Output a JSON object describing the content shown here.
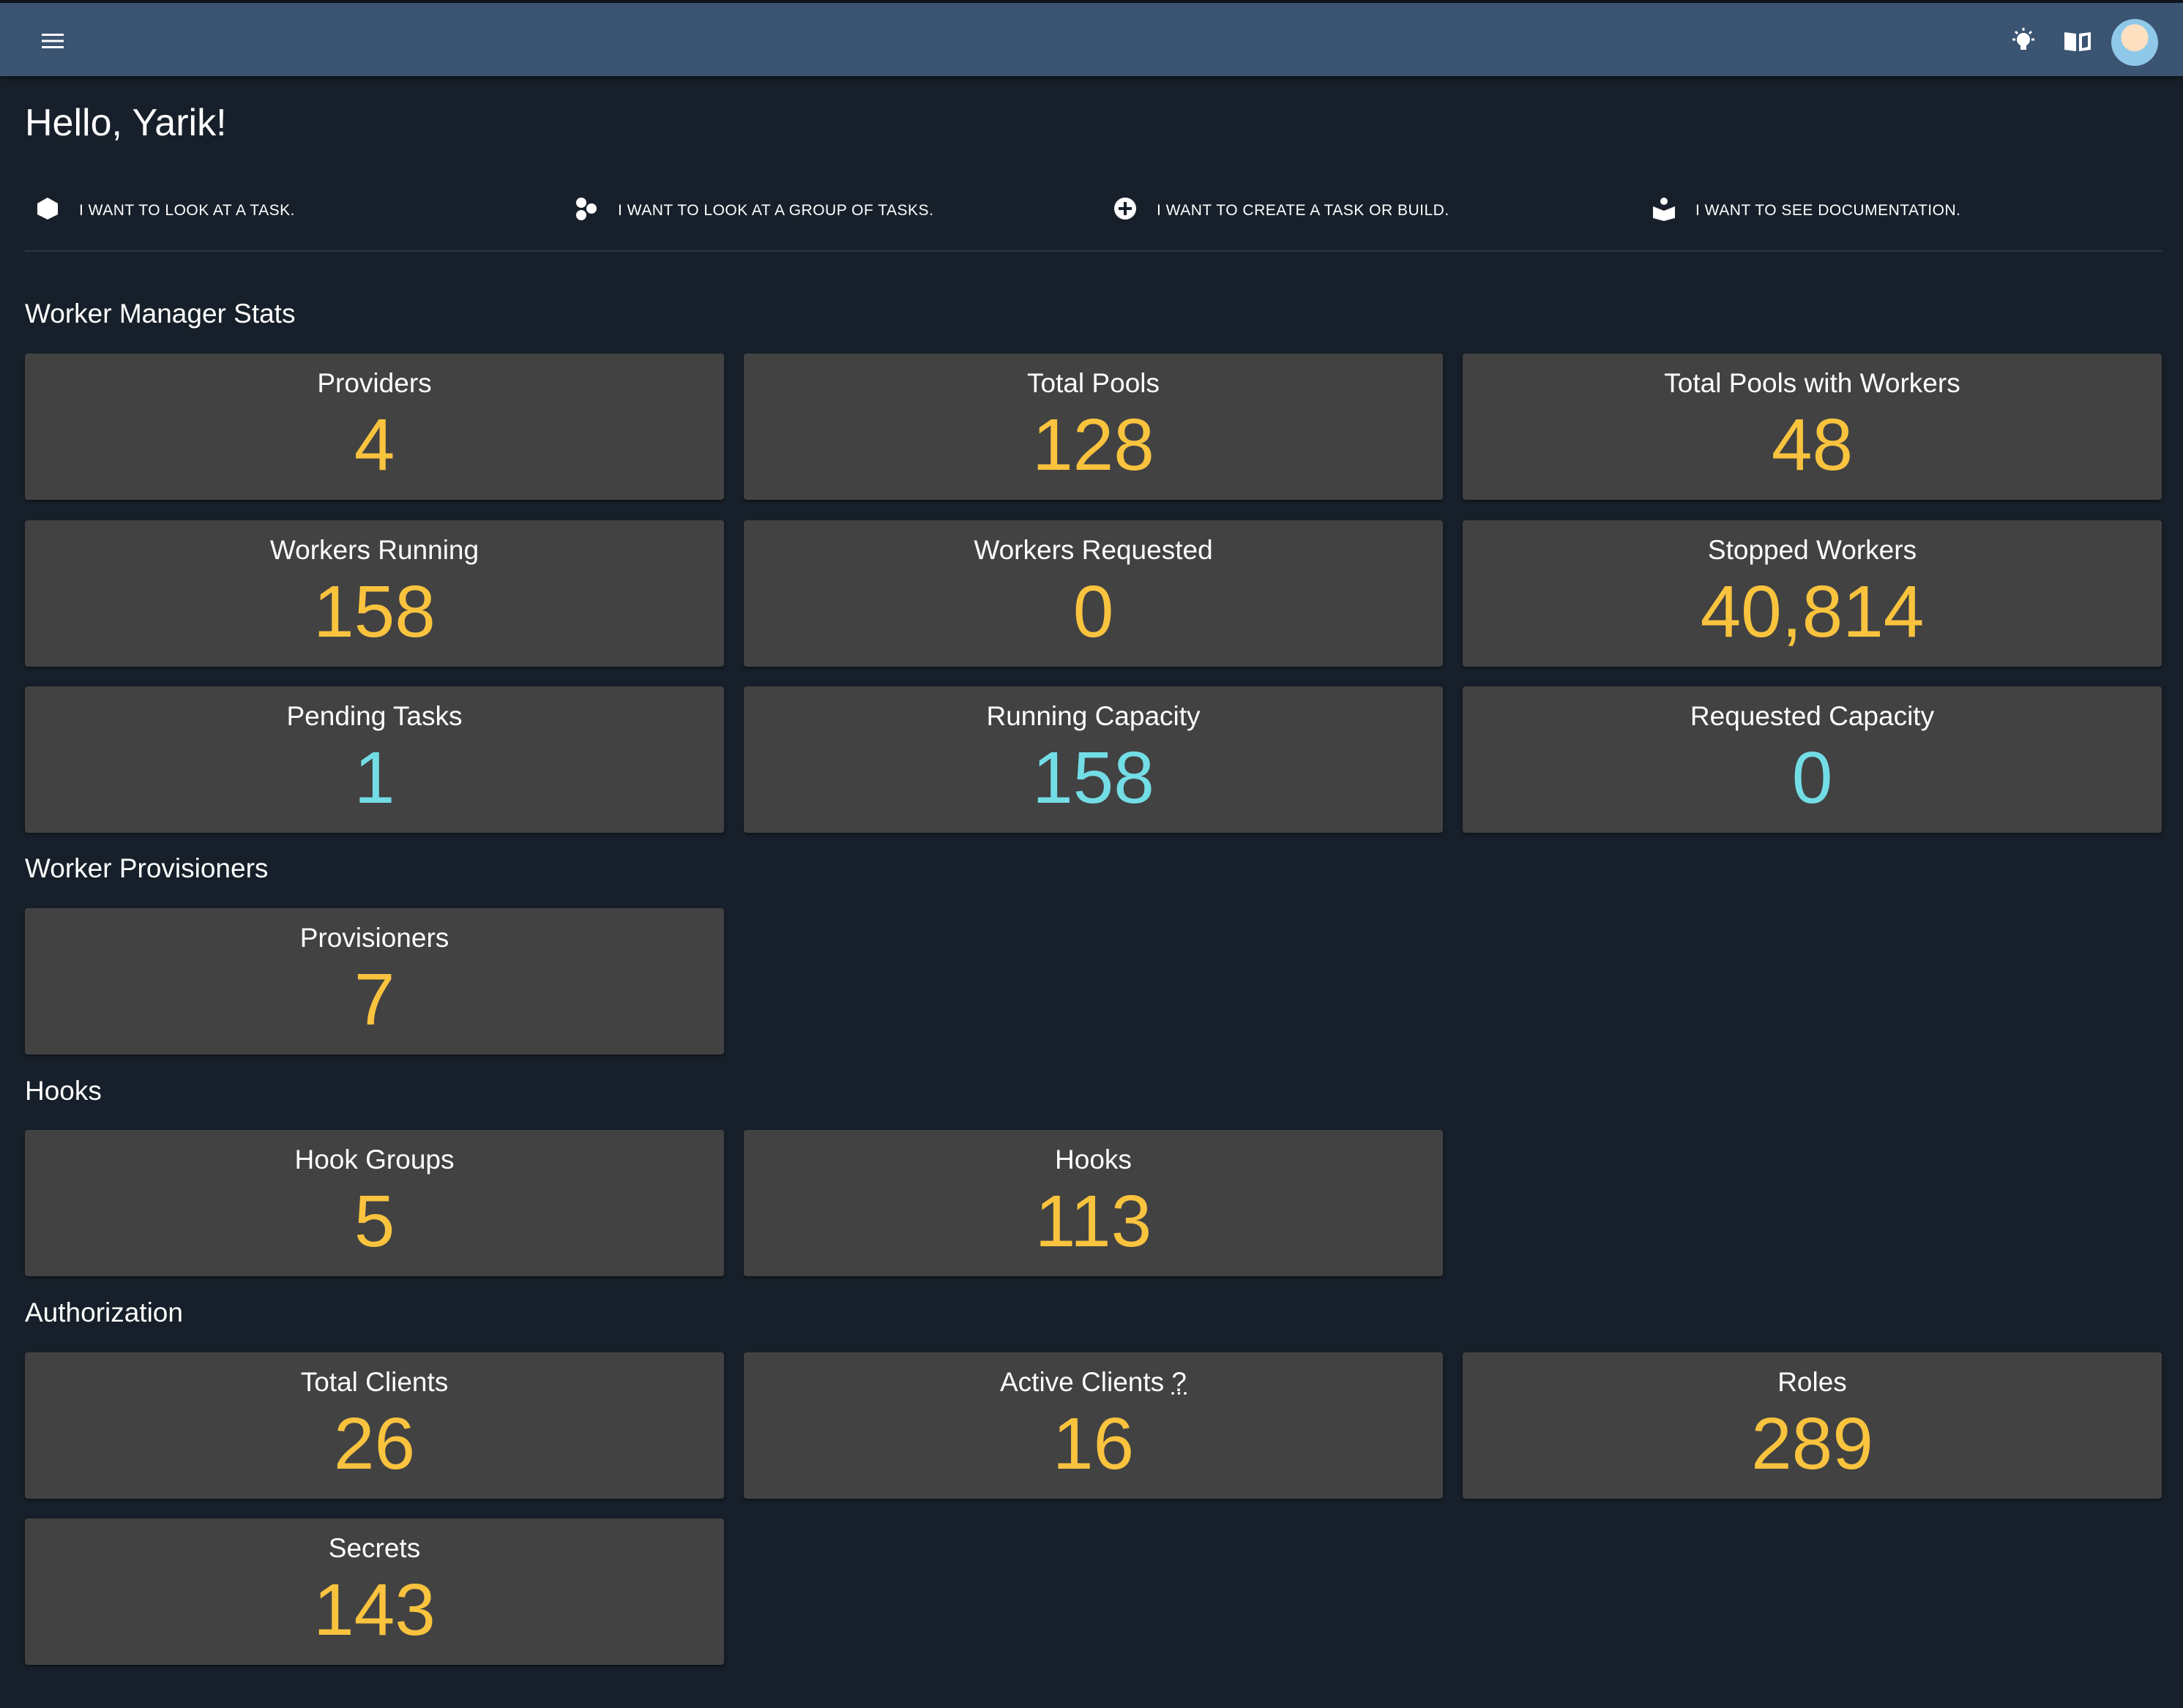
{
  "header": {
    "menu_icon": "menu-icon",
    "theme_icon": "lightbulb-icon",
    "docs_icon": "book-icon",
    "avatar_icon": "avatar"
  },
  "greeting": "Hello, Yarik!",
  "actions": [
    {
      "label": "I WANT TO LOOK AT A TASK.",
      "icon": "hexagon-icon"
    },
    {
      "label": "I WANT TO LOOK AT A GROUP OF TASKS.",
      "icon": "group-icon"
    },
    {
      "label": "I WANT TO CREATE A TASK OR BUILD.",
      "icon": "plus-circle-icon"
    },
    {
      "label": "I WANT TO SEE DOCUMENTATION.",
      "icon": "book-open-icon"
    }
  ],
  "sections": {
    "worker_manager": {
      "title": "Worker Manager Stats",
      "cards": [
        {
          "label": "Providers",
          "value": "4"
        },
        {
          "label": "Total Pools",
          "value": "128"
        },
        {
          "label": "Total Pools with Workers",
          "value": "48"
        },
        {
          "label": "Workers Running",
          "value": "158"
        },
        {
          "label": "Workers Requested",
          "value": "0"
        },
        {
          "label": "Stopped Workers",
          "value": "40,814"
        },
        {
          "label": "Pending Tasks",
          "value": "1"
        },
        {
          "label": "Running Capacity",
          "value": "158"
        },
        {
          "label": "Requested Capacity",
          "value": "0"
        }
      ]
    },
    "provisioners": {
      "title": "Worker Provisioners",
      "cards": [
        {
          "label": "Provisioners",
          "value": "7"
        }
      ]
    },
    "hooks": {
      "title": "Hooks",
      "cards": [
        {
          "label": "Hook Groups",
          "value": "5"
        },
        {
          "label": "Hooks",
          "value": "113"
        }
      ]
    },
    "authorization": {
      "title": "Authorization",
      "cards": [
        {
          "label": "Total Clients",
          "value": "26"
        },
        {
          "label": "Active Clients",
          "value": "16",
          "hint": "?"
        },
        {
          "label": "Roles",
          "value": "289"
        },
        {
          "label": "Secrets",
          "value": "143"
        }
      ]
    }
  },
  "colors": {
    "background": "#17202a",
    "appbar": "#3b5472",
    "card": "#424242",
    "value_yellow": "#f9c33e",
    "value_cyan": "#73dde6"
  }
}
